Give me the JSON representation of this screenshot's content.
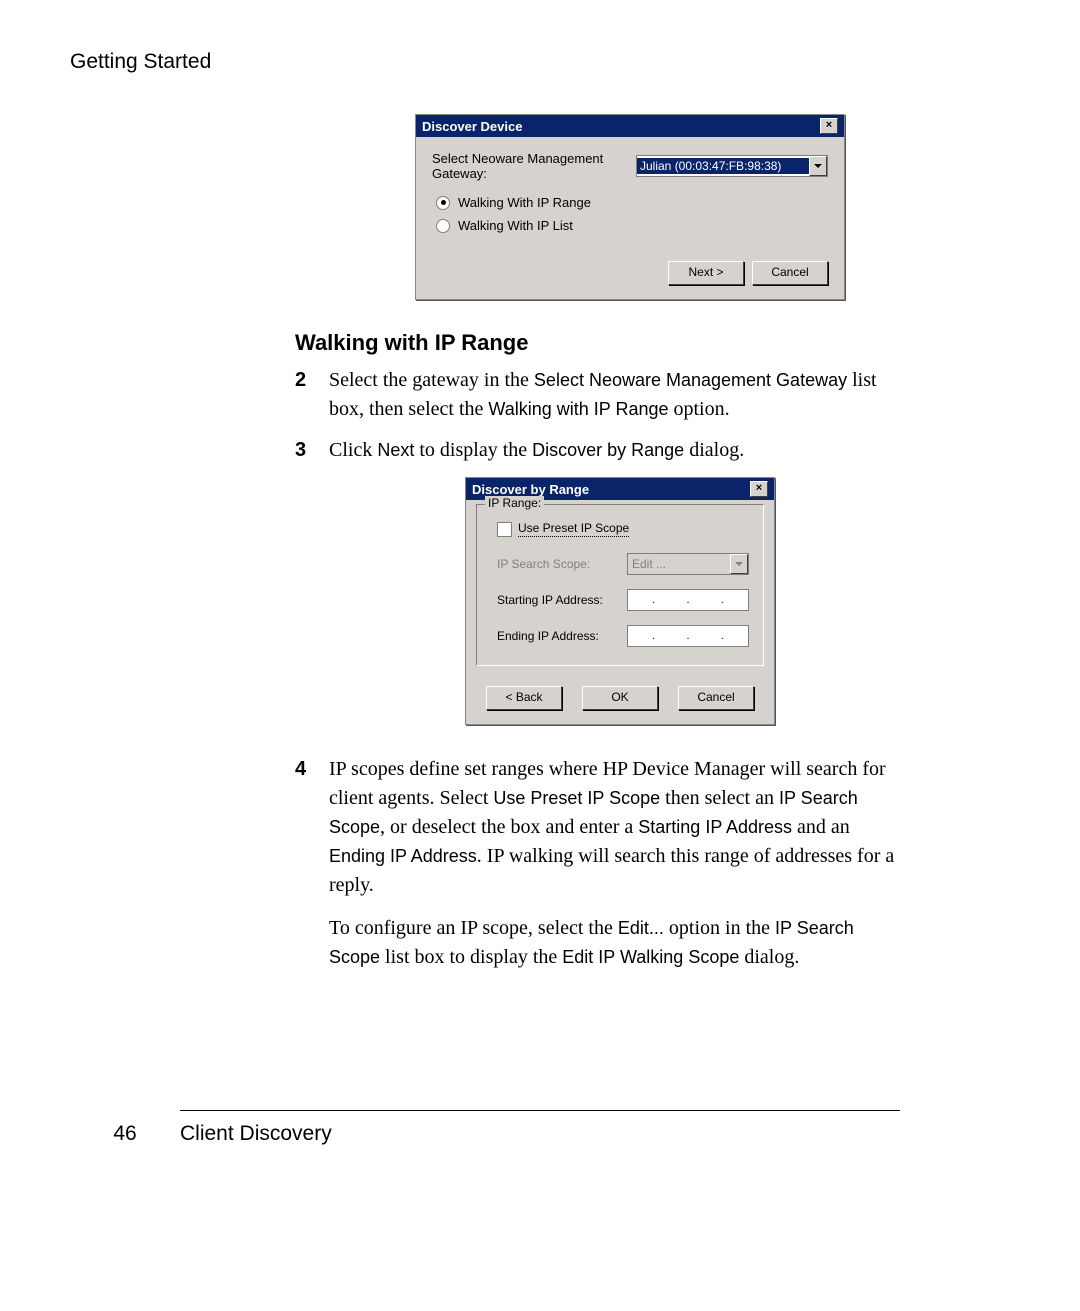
{
  "running_head": "Getting Started",
  "dialog1": {
    "title": "Discover Device",
    "gateway_label": "Select Neoware Management Gateway:",
    "gateway_value": "Julian (00:03:47:FB:98:38)",
    "radio1": "Walking With IP Range",
    "radio2": "Walking With IP List",
    "next": "Next >",
    "cancel": "Cancel"
  },
  "section_heading": "Walking with IP Range",
  "step2": {
    "num": "2",
    "t1": "Select the gateway in the ",
    "u1": "Select Neoware Management Gateway",
    "t2": " list box, then select the ",
    "u2": "Walking with IP Range",
    "t3": " option."
  },
  "step3": {
    "num": "3",
    "t1": "Click ",
    "u1": "Next",
    "t2": " to display the ",
    "u2": "Discover by Range",
    "t3": " dialog."
  },
  "dialog2": {
    "title": "Discover by Range",
    "legend": "IP Range:",
    "use_preset": "Use Preset IP Scope",
    "scope_label": "IP Search Scope:",
    "scope_value": "Edit ...",
    "start_label": "Starting IP Address:",
    "end_label": "Ending IP Address:",
    "back": "< Back",
    "ok": "OK",
    "cancel": "Cancel"
  },
  "step4": {
    "num": "4",
    "t1": "IP scopes define set ranges where HP Device Manager will search for client agents. Select ",
    "u1": "Use Preset IP Scope",
    "t2": " then select an ",
    "u2": "IP Search Scope",
    "t3": ", or deselect the box and enter a ",
    "u3": "Starting IP Address",
    "t4": " and an ",
    "u4": "Ending IP Address",
    "t5": ". IP walking will search this range of addresses for a reply."
  },
  "para": {
    "t1": "To configure an IP scope, select the ",
    "u1": "Edit...",
    "t2": " option in the ",
    "u2": "IP Search Scope",
    "t3": " list box to display the ",
    "u3": "Edit IP Walking Scope",
    "t4": " dialog."
  },
  "page_number": "46",
  "footer_section": "Client Discovery"
}
